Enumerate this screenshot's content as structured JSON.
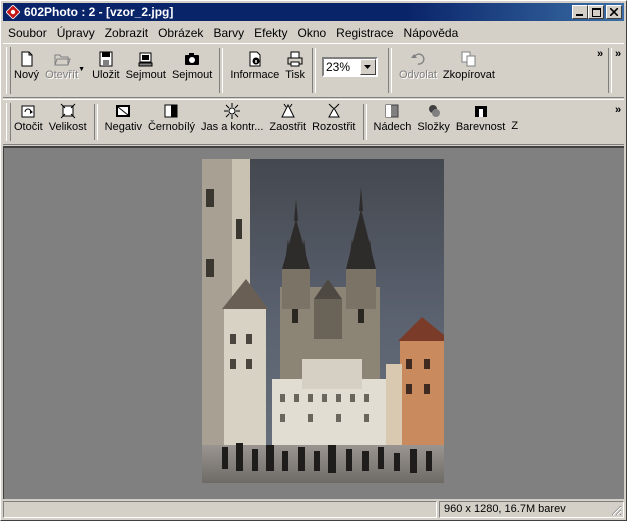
{
  "window": {
    "title": "602Photo : 2 - [vzor_2.jpg]",
    "buttons": [
      "minimize",
      "maximize",
      "close"
    ]
  },
  "menu": [
    {
      "label": "Soubor"
    },
    {
      "label": "Úpravy"
    },
    {
      "label": "Zobrazit"
    },
    {
      "label": "Obrázek"
    },
    {
      "label": "Barvy"
    },
    {
      "label": "Efekty"
    },
    {
      "label": "Okno"
    },
    {
      "label": "Registrace"
    },
    {
      "label": "Nápověda"
    }
  ],
  "toolbar1": {
    "new": "Nový",
    "open": "Otevřít",
    "save": "Uložit",
    "capture1": "Sejmout",
    "capture2": "Sejmout",
    "info": "Informace",
    "print": "Tisk",
    "zoom": "23%",
    "undo": "Odvolat",
    "copy": "Zkopírovat",
    "more": "»"
  },
  "toolbar2": {
    "rotate": "Otočit",
    "size": "Velikost",
    "negative": "Negativ",
    "bw": "Černobílý",
    "brightness": "Jas a kontr...",
    "sharpen": "Zaostřit",
    "blur": "Rozostřit",
    "tint": "Nádech",
    "components": "Složky",
    "color": "Barevnost",
    "cut": "Z",
    "more": "»"
  },
  "status": {
    "left": "",
    "info": "960 x 1280, 16.7M barev"
  },
  "colors": {
    "title_active": "#0a246a",
    "face": "#d4d0c8",
    "workspace": "#808080"
  }
}
